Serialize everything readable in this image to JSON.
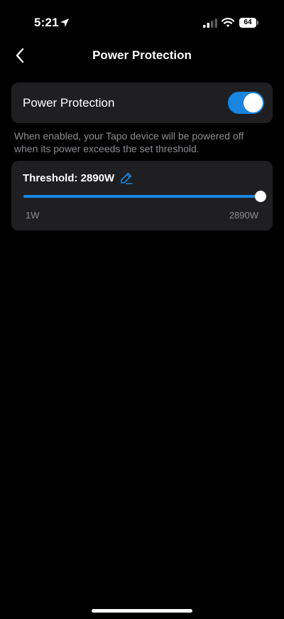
{
  "status_bar": {
    "time": "5:21",
    "battery": "64",
    "icons": [
      "location-arrow-icon",
      "signal-icon",
      "wifi-icon",
      "battery-icon"
    ]
  },
  "nav": {
    "back_icon": "chevron-left-icon",
    "title": "Power Protection"
  },
  "toggle_card": {
    "label": "Power Protection",
    "enabled": true
  },
  "description": "When enabled, your Tapo device will be powered off when its power exceeds the set threshold.",
  "threshold": {
    "label": "Threshold: 2890W",
    "edit_icon": "pencil-icon",
    "value": 2890,
    "min": 1,
    "max": 2890,
    "min_label": "1W",
    "max_label": "2890W"
  },
  "colors": {
    "accent": "#1a85e0",
    "background": "#000000",
    "card": "#1f1f21",
    "secondary_text": "#8e8e93"
  }
}
